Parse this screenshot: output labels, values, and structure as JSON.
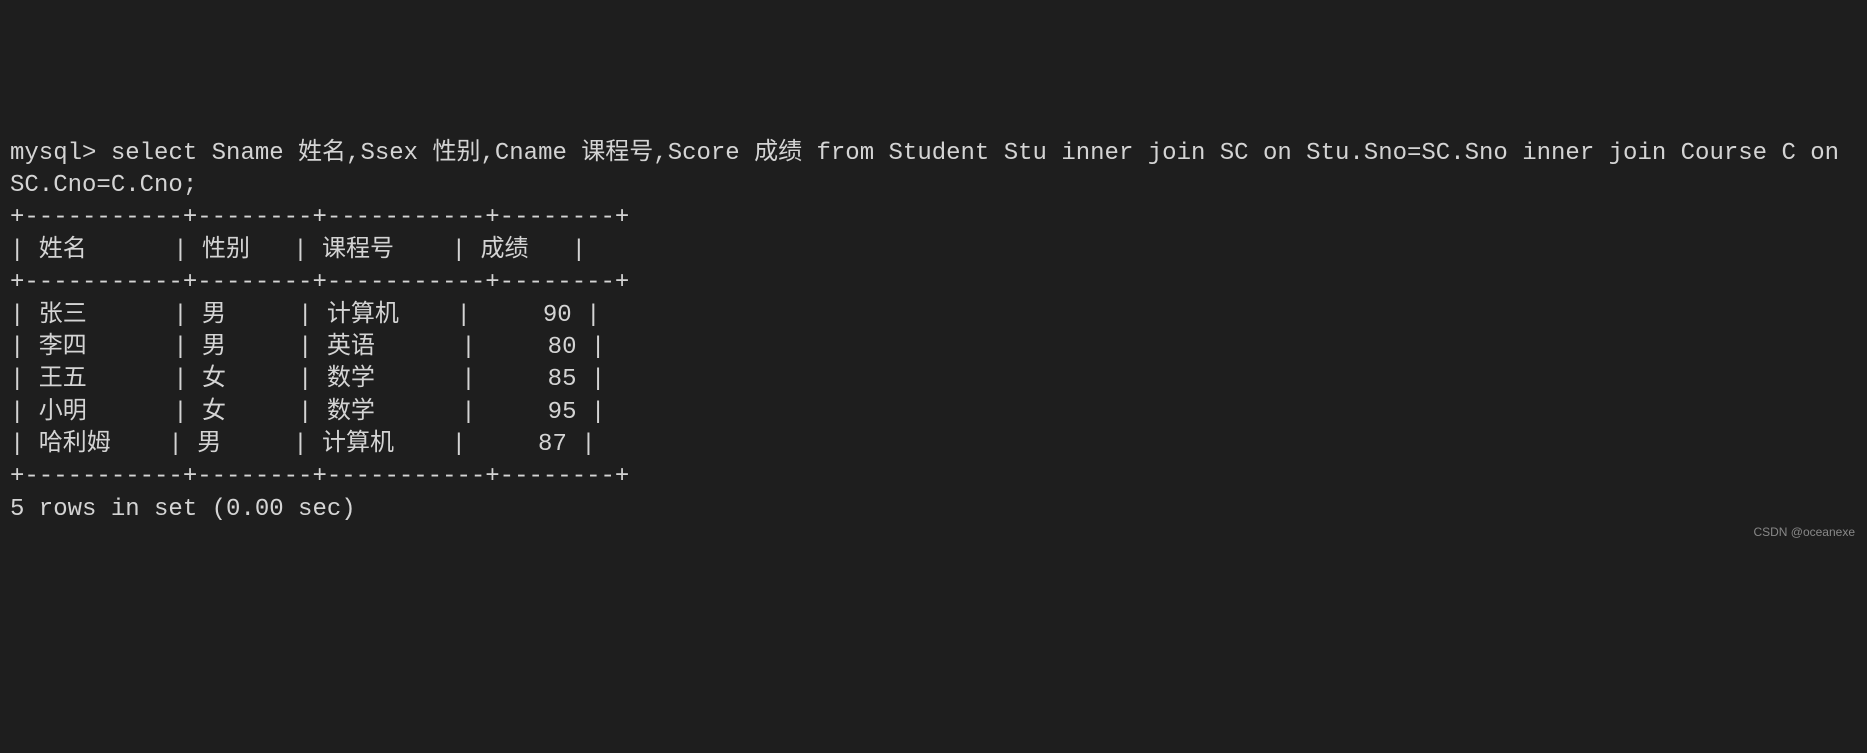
{
  "terminal": {
    "prompt": "mysql>",
    "query": "select Sname 姓名,Ssex 性别,Cname 课程号,Score 成绩 from Student Stu inner join SC on Stu.Sno=SC.Sno inner join Course C on SC.Cno=C.Cno;",
    "table": {
      "border_top": "+-----------+--------+-----------+--------+",
      "header_row": "| 姓名      | 性别   | 课程号    | 成绩   |",
      "border_mid": "+-----------+--------+-----------+--------+",
      "rows": [
        "| 张三      | 男     | 计算机    |     90 |",
        "| 李四      | 男     | 英语      |     80 |",
        "| 王五      | 女     | 数学      |     85 |",
        "| 小明      | 女     | 数学      |     95 |",
        "| 哈利姆    | 男     | 计算机    |     87 |"
      ],
      "border_bot": "+-----------+--------+-----------+--------+"
    },
    "status": "5 rows in set (0.00 sec)",
    "columns": [
      "姓名",
      "性别",
      "课程号",
      "成绩"
    ],
    "data": [
      {
        "姓名": "张三",
        "性别": "男",
        "课程号": "计算机",
        "成绩": 90
      },
      {
        "姓名": "李四",
        "性别": "男",
        "课程号": "英语",
        "成绩": 80
      },
      {
        "姓名": "王五",
        "性别": "女",
        "课程号": "数学",
        "成绩": 85
      },
      {
        "姓名": "小明",
        "性别": "女",
        "课程号": "数学",
        "成绩": 95
      },
      {
        "姓名": "哈利姆",
        "性别": "男",
        "课程号": "计算机",
        "成绩": 87
      }
    ]
  },
  "watermark": "CSDN @oceanexe"
}
